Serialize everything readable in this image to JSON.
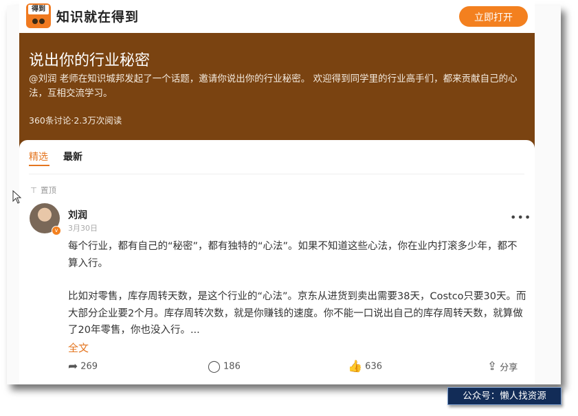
{
  "appbar": {
    "logo_text": "得到",
    "app_name": "知识就在得到",
    "open_button": "立即打开"
  },
  "topic": {
    "title": "说出你的行业秘密",
    "description": "@刘润 老师在知识城邦发起了一个话题，邀请你说出你的行业秘密。 欢迎得到同学里的行业高手们，都来贡献自己的心法，互相交流学习。",
    "stats": "360条讨论·2.3万次阅读"
  },
  "tabs": {
    "featured": "精选",
    "latest": "最新"
  },
  "pinned_label": "置顶",
  "post": {
    "author": "刘润",
    "date": "3月30日",
    "paragraph1": "每个行业，都有自己的“秘密”，都有独特的“心法”。如果不知道这些心法，你在业内打滚多少年，都不算入行。",
    "paragraph2": "比如对零售，库存周转天数，是这个行业的“心法”。京东从进货到卖出需要38天，Costco只要30天。而大部分企业要2个月。库存周转次数，就是你赚钱的速度。你不能一口说出自己的库存周转天数，就算做了20年零售，你也没入行。...",
    "read_more": "全文",
    "shares": "269",
    "comments": "186",
    "likes": "636",
    "share_label": "分享"
  },
  "watermark": "公众号：懒人找资源",
  "colors": {
    "accent": "#f3801f",
    "header_bg": "#7a4311",
    "watermark_bg": "#122c57"
  }
}
